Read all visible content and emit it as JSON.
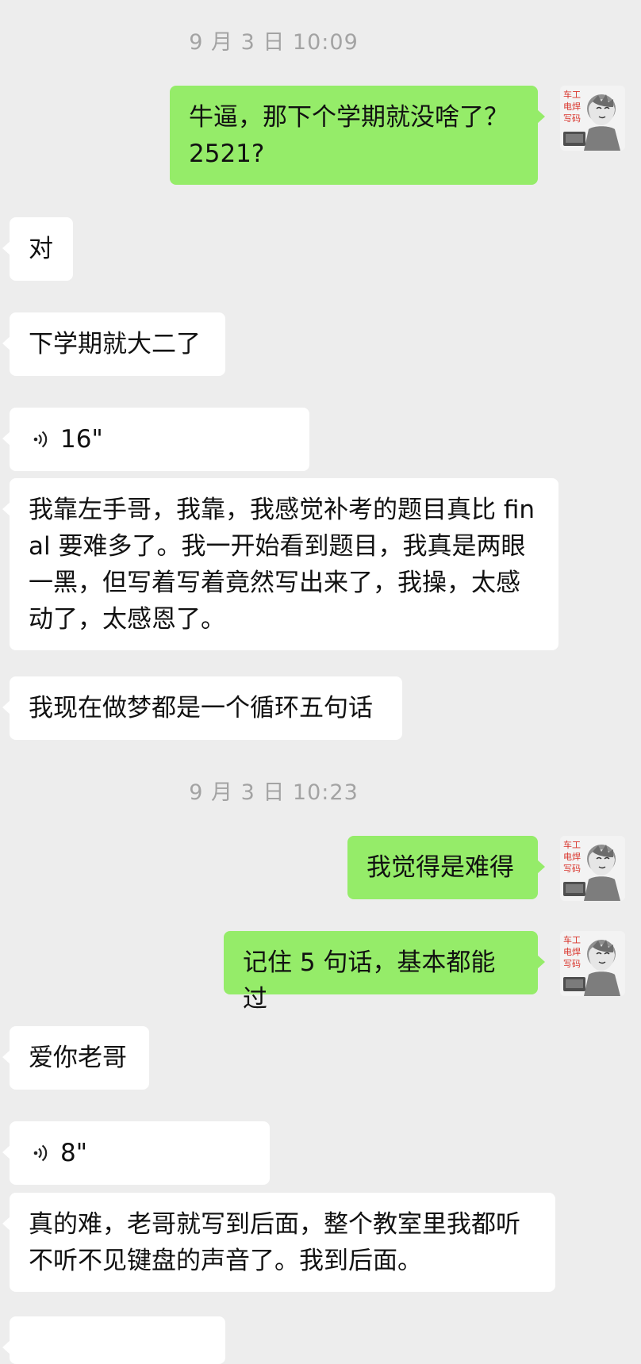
{
  "chat": {
    "timestamps": [
      "9 月 3 日 10:09",
      "9 月 3 日 10:23"
    ],
    "messages": [
      {
        "side": "out",
        "text": "牛逼，那下个学期就没啥了？2521?"
      },
      {
        "side": "in",
        "text": "对"
      },
      {
        "side": "in",
        "text": "下学期就大二了"
      },
      {
        "side": "in",
        "type": "voice",
        "duration": "16\""
      },
      {
        "side": "in",
        "text": "我靠左手哥，我靠，我感觉补考的题目真比 final 要难多了。我一开始看到题目，我真是两眼一黑，但写着写着竟然写出来了，我操，太感动了，太感恩了。"
      },
      {
        "side": "in",
        "text": "我现在做梦都是一个循环五句话"
      },
      {
        "side": "out",
        "text": "我觉得是难得"
      },
      {
        "side": "out",
        "text": "记住 5 句话，基本都能过"
      },
      {
        "side": "in",
        "text": "爱你老哥"
      },
      {
        "side": "in",
        "type": "voice",
        "duration": "8\""
      },
      {
        "side": "in",
        "text": "真的难，老哥就写到后面，整个教室里我都听不听不见键盘的声音了。我到后面。"
      },
      {
        "side": "in",
        "text": ""
      }
    ],
    "avatar": {
      "icon": "cartoon-avatar-icon",
      "text_lines": [
        "车工",
        "电焊",
        "写码"
      ],
      "text_color": "#d9342b"
    },
    "colors": {
      "background": "#ededed",
      "incoming_bubble": "#ffffff",
      "outgoing_bubble": "#95ec69",
      "timestamp": "#a3a3a3"
    }
  }
}
